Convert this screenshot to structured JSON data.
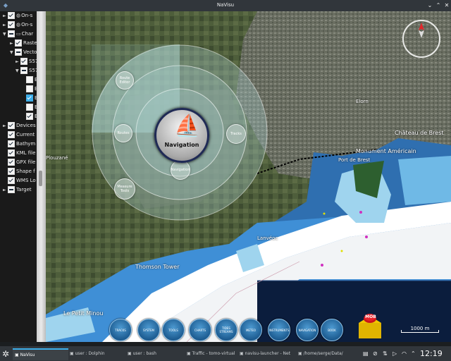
{
  "window": {
    "title": "NaVisu",
    "app_icon": "navisu-app-icon",
    "controls": [
      "minimize-icon",
      "maximize-icon",
      "close-icon"
    ]
  },
  "layers_panel": {
    "items": [
      {
        "label": "On-s",
        "checked": "checked",
        "expander": "►",
        "icon": "globe-icon"
      },
      {
        "label": "On-s",
        "checked": "checked",
        "expander": "►",
        "icon": "globe-icon"
      },
      {
        "label": "Char",
        "checked": "partial",
        "expander": "▼",
        "icon": "folder-icon"
      },
      {
        "label": "Raste",
        "checked": "checked",
        "expander": "►",
        "icon": ""
      },
      {
        "label": "Vecto",
        "checked": "partial",
        "expander": "▼",
        "icon": ""
      },
      {
        "label": "S57",
        "checked": "checked",
        "expander": "►",
        "icon": ""
      },
      {
        "label": "S57",
        "checked": "partial",
        "expander": "▼",
        "icon": ""
      },
      {
        "label": "E",
        "checked": "unchecked",
        "expander": "",
        "icon": ""
      },
      {
        "label": "E",
        "checked": "unchecked",
        "expander": "",
        "icon": ""
      },
      {
        "label": "E",
        "checked": "blue",
        "expander": "",
        "icon": ""
      },
      {
        "label": "E",
        "checked": "unchecked",
        "expander": "",
        "icon": ""
      },
      {
        "label": "E",
        "checked": "checked",
        "expander": "",
        "icon": ""
      },
      {
        "label": "Devices",
        "checked": "checked",
        "expander": "►",
        "icon": ""
      },
      {
        "label": "Current",
        "checked": "checked",
        "expander": "",
        "icon": ""
      },
      {
        "label": "Bathym",
        "checked": "checked",
        "expander": "",
        "icon": ""
      },
      {
        "label": "KML file",
        "checked": "checked",
        "expander": "",
        "icon": ""
      },
      {
        "label": "GPX file",
        "checked": "checked",
        "expander": "",
        "icon": ""
      },
      {
        "label": "Shape f",
        "checked": "checked",
        "expander": "",
        "icon": ""
      },
      {
        "label": "WMS Lo",
        "checked": "checked",
        "expander": "",
        "icon": ""
      },
      {
        "label": "Target",
        "checked": "partial",
        "expander": "►",
        "icon": ""
      }
    ]
  },
  "map": {
    "labels": {
      "chateau": "Château de Brest",
      "monument": "Monument Américain",
      "port": "Port de Brest",
      "thomson": "Thomson Tower",
      "petit_minou": "Le Petit Minou",
      "lanvéoc": "Lanvéoc",
      "plouzane": "Plouzané",
      "river": "Elorn"
    }
  },
  "radial_menu": {
    "center_label": "Navigation",
    "route_editor": "Route Editor",
    "routes": "Routes",
    "tracks": "Tracks",
    "measure_tools": "Measure Tools",
    "navigation_small": "Navigation"
  },
  "dock": {
    "buttons": [
      {
        "label": "TRACKS",
        "name": "tracks-dock-button"
      },
      {
        "label": "SYSTEM",
        "name": "system-dock-button"
      },
      {
        "label": "TOOLS",
        "name": "tools-dock-button"
      },
      {
        "label": "CHARTS",
        "name": "charts-dock-button"
      },
      {
        "label": "TIDES STREAMS",
        "name": "tides-streams-dock-button"
      },
      {
        "label": "METEO",
        "name": "meteo-dock-button"
      },
      {
        "label": "INSTRUMENTS",
        "name": "instruments-dock-button"
      },
      {
        "label": "NAVIGATION",
        "name": "navigation-dock-button"
      },
      {
        "label": "BOOK",
        "name": "book-dock-button"
      }
    ],
    "mob_label": "MOB",
    "scale_label": "1000 m"
  },
  "taskbar": {
    "tasks": [
      {
        "label": "NaVisu",
        "active": true,
        "icon": "java-icon"
      },
      {
        "label": "user : Dolphin",
        "active": false,
        "icon": "dolphin-icon"
      },
      {
        "label": "user : bash",
        "active": false,
        "icon": "terminal-icon"
      },
      {
        "label": "Traffic - tomo-virtual",
        "active": false,
        "icon": "browser-icon"
      },
      {
        "label": "navisu-launcher - Net",
        "active": false,
        "icon": "netbeans-icon"
      },
      {
        "label": "/home/serge/Data/",
        "active": false,
        "icon": "folder-icon"
      }
    ],
    "clock": "12:19"
  },
  "colors": {
    "accent": "#3daee9",
    "sea_deep": "#ffffff",
    "sea_shallow": "#9fd4ee",
    "sea_mid": "#4ba3dd",
    "land": "#3d4a30"
  }
}
